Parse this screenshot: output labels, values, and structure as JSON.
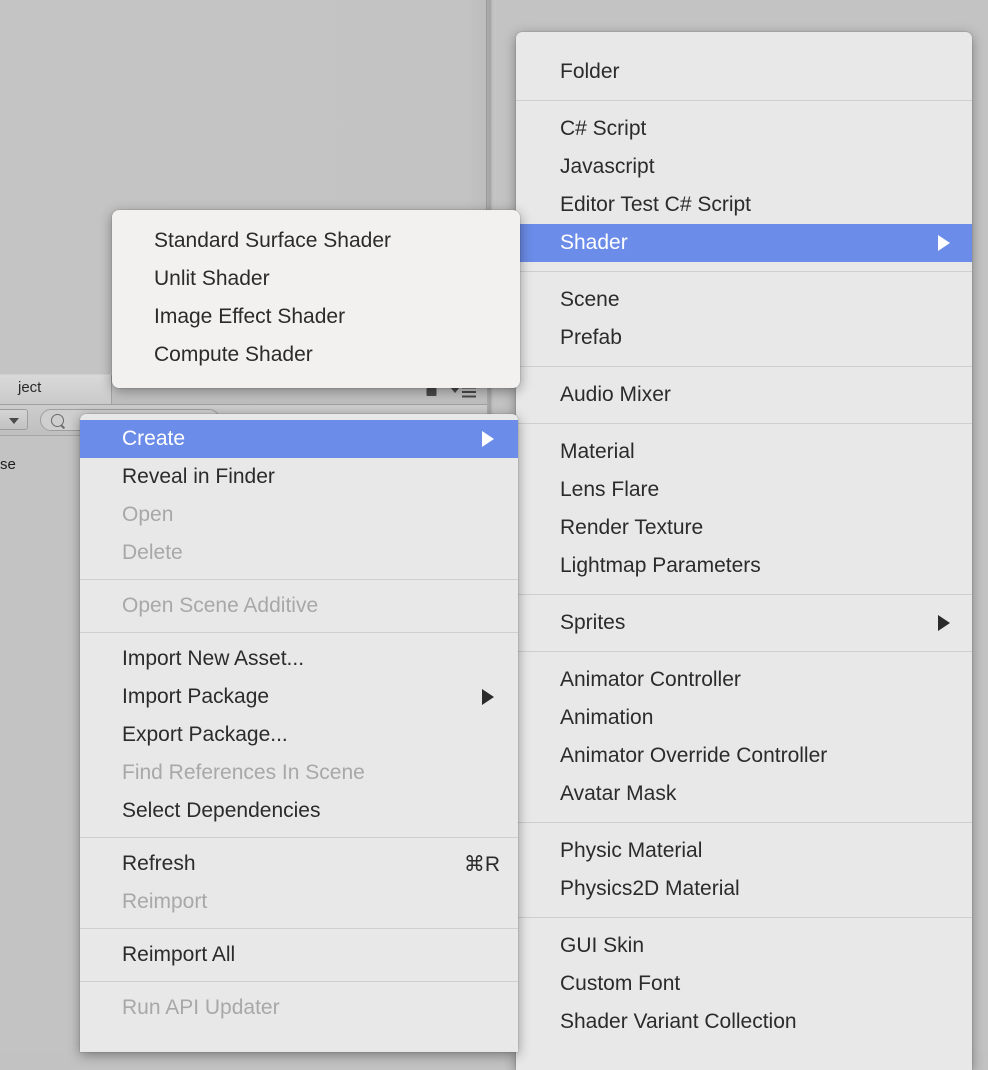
{
  "editor": {
    "project_tab_label": "ject",
    "breadcrumb_fragment": "se",
    "lock_icon": "lock-icon",
    "panel_menu_icon": "hamburger-menu-icon",
    "search_icon": "search-icon",
    "filter_dropdown_icon": "chevron-down-icon"
  },
  "colors": {
    "menu_background": "#e8e8e8",
    "menu_highlight": "#6b8ce8",
    "menu_text": "#2b2b2b",
    "menu_disabled_text": "#a8a8a8",
    "submenu_background": "#f2f1f0",
    "editor_background": "#c3c3c3"
  },
  "context_menu": {
    "name": "Project asset context menu",
    "groups": [
      {
        "items": [
          {
            "label": "Create",
            "enabled": true,
            "selected": true,
            "submenu": true,
            "shortcut": ""
          },
          {
            "label": "Reveal in Finder",
            "enabled": true,
            "selected": false,
            "submenu": false,
            "shortcut": ""
          },
          {
            "label": "Open",
            "enabled": false,
            "selected": false,
            "submenu": false,
            "shortcut": ""
          },
          {
            "label": "Delete",
            "enabled": false,
            "selected": false,
            "submenu": false,
            "shortcut": ""
          }
        ]
      },
      {
        "items": [
          {
            "label": "Open Scene Additive",
            "enabled": false,
            "selected": false,
            "submenu": false,
            "shortcut": ""
          }
        ]
      },
      {
        "items": [
          {
            "label": "Import New Asset...",
            "enabled": true,
            "selected": false,
            "submenu": false,
            "shortcut": ""
          },
          {
            "label": "Import Package",
            "enabled": true,
            "selected": false,
            "submenu": true,
            "shortcut": ""
          },
          {
            "label": "Export Package...",
            "enabled": true,
            "selected": false,
            "submenu": false,
            "shortcut": ""
          },
          {
            "label": "Find References In Scene",
            "enabled": false,
            "selected": false,
            "submenu": false,
            "shortcut": ""
          },
          {
            "label": "Select Dependencies",
            "enabled": true,
            "selected": false,
            "submenu": false,
            "shortcut": ""
          }
        ]
      },
      {
        "items": [
          {
            "label": "Refresh",
            "enabled": true,
            "selected": false,
            "submenu": false,
            "shortcut": "⌘R"
          },
          {
            "label": "Reimport",
            "enabled": false,
            "selected": false,
            "submenu": false,
            "shortcut": ""
          }
        ]
      },
      {
        "items": [
          {
            "label": "Reimport All",
            "enabled": true,
            "selected": false,
            "submenu": false,
            "shortcut": ""
          }
        ]
      },
      {
        "items": [
          {
            "label": "Run API Updater",
            "enabled": false,
            "selected": false,
            "submenu": false,
            "shortcut": ""
          }
        ]
      }
    ]
  },
  "create_submenu": {
    "name": "Create submenu",
    "groups": [
      {
        "items": [
          {
            "label": "Folder",
            "enabled": true,
            "selected": false,
            "submenu": false,
            "shortcut": ""
          }
        ]
      },
      {
        "items": [
          {
            "label": "C# Script",
            "enabled": true,
            "selected": false,
            "submenu": false,
            "shortcut": ""
          },
          {
            "label": "Javascript",
            "enabled": true,
            "selected": false,
            "submenu": false,
            "shortcut": ""
          },
          {
            "label": "Editor Test C# Script",
            "enabled": true,
            "selected": false,
            "submenu": false,
            "shortcut": ""
          },
          {
            "label": "Shader",
            "enabled": true,
            "selected": true,
            "submenu": true,
            "shortcut": ""
          }
        ]
      },
      {
        "items": [
          {
            "label": "Scene",
            "enabled": true,
            "selected": false,
            "submenu": false,
            "shortcut": ""
          },
          {
            "label": "Prefab",
            "enabled": true,
            "selected": false,
            "submenu": false,
            "shortcut": ""
          }
        ]
      },
      {
        "items": [
          {
            "label": "Audio Mixer",
            "enabled": true,
            "selected": false,
            "submenu": false,
            "shortcut": ""
          }
        ]
      },
      {
        "items": [
          {
            "label": "Material",
            "enabled": true,
            "selected": false,
            "submenu": false,
            "shortcut": ""
          },
          {
            "label": "Lens Flare",
            "enabled": true,
            "selected": false,
            "submenu": false,
            "shortcut": ""
          },
          {
            "label": "Render Texture",
            "enabled": true,
            "selected": false,
            "submenu": false,
            "shortcut": ""
          },
          {
            "label": "Lightmap Parameters",
            "enabled": true,
            "selected": false,
            "submenu": false,
            "shortcut": ""
          }
        ]
      },
      {
        "items": [
          {
            "label": "Sprites",
            "enabled": true,
            "selected": false,
            "submenu": true,
            "shortcut": ""
          }
        ]
      },
      {
        "items": [
          {
            "label": "Animator Controller",
            "enabled": true,
            "selected": false,
            "submenu": false,
            "shortcut": ""
          },
          {
            "label": "Animation",
            "enabled": true,
            "selected": false,
            "submenu": false,
            "shortcut": ""
          },
          {
            "label": "Animator Override Controller",
            "enabled": true,
            "selected": false,
            "submenu": false,
            "shortcut": ""
          },
          {
            "label": "Avatar Mask",
            "enabled": true,
            "selected": false,
            "submenu": false,
            "shortcut": ""
          }
        ]
      },
      {
        "items": [
          {
            "label": "Physic Material",
            "enabled": true,
            "selected": false,
            "submenu": false,
            "shortcut": ""
          },
          {
            "label": "Physics2D Material",
            "enabled": true,
            "selected": false,
            "submenu": false,
            "shortcut": ""
          }
        ]
      },
      {
        "items": [
          {
            "label": "GUI Skin",
            "enabled": true,
            "selected": false,
            "submenu": false,
            "shortcut": ""
          },
          {
            "label": "Custom Font",
            "enabled": true,
            "selected": false,
            "submenu": false,
            "shortcut": ""
          },
          {
            "label": "Shader Variant Collection",
            "enabled": true,
            "selected": false,
            "submenu": false,
            "shortcut": ""
          }
        ]
      }
    ]
  },
  "shader_submenu": {
    "name": "Shader submenu",
    "groups": [
      {
        "items": [
          {
            "label": "Standard Surface Shader",
            "enabled": true,
            "selected": false,
            "submenu": false,
            "shortcut": ""
          },
          {
            "label": "Unlit Shader",
            "enabled": true,
            "selected": false,
            "submenu": false,
            "shortcut": ""
          },
          {
            "label": "Image Effect Shader",
            "enabled": true,
            "selected": false,
            "submenu": false,
            "shortcut": ""
          },
          {
            "label": "Compute Shader",
            "enabled": true,
            "selected": false,
            "submenu": false,
            "shortcut": ""
          }
        ]
      }
    ]
  }
}
